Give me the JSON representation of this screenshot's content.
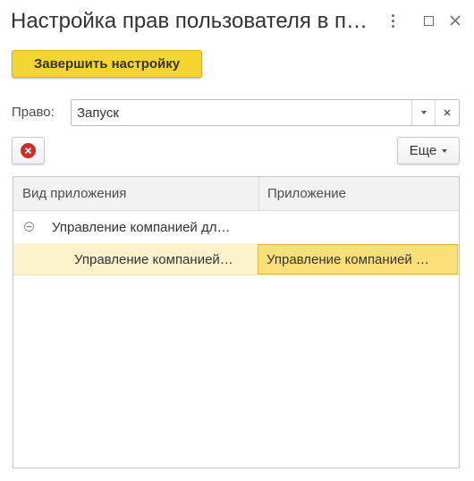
{
  "window": {
    "title": "Настройка прав пользователя в пр…"
  },
  "toolbar": {
    "finish_label": "Завершить настройку"
  },
  "right_field": {
    "label": "Право:",
    "value": "Запуск"
  },
  "actions": {
    "more_label": "Еще"
  },
  "table": {
    "columns": [
      "Вид приложения",
      "Приложение"
    ],
    "rows": [
      {
        "type": "Управление компанией дл…",
        "app": ""
      },
      {
        "type": "Управление компанией…",
        "app": "Управление компанией …"
      }
    ]
  },
  "colors": {
    "accent": "#f5d532",
    "selected_row": "#fcf3cd",
    "selected_cell": "#fbdf78",
    "delete_icon": "#d42a2a"
  },
  "icons": {
    "more": "three-dots-vertical-icon",
    "maximize": "maximize-icon",
    "close": "close-icon",
    "dropdown": "chevron-down-icon",
    "clear": "clear-icon",
    "delete": "delete-icon",
    "collapse": "collapse-icon"
  }
}
